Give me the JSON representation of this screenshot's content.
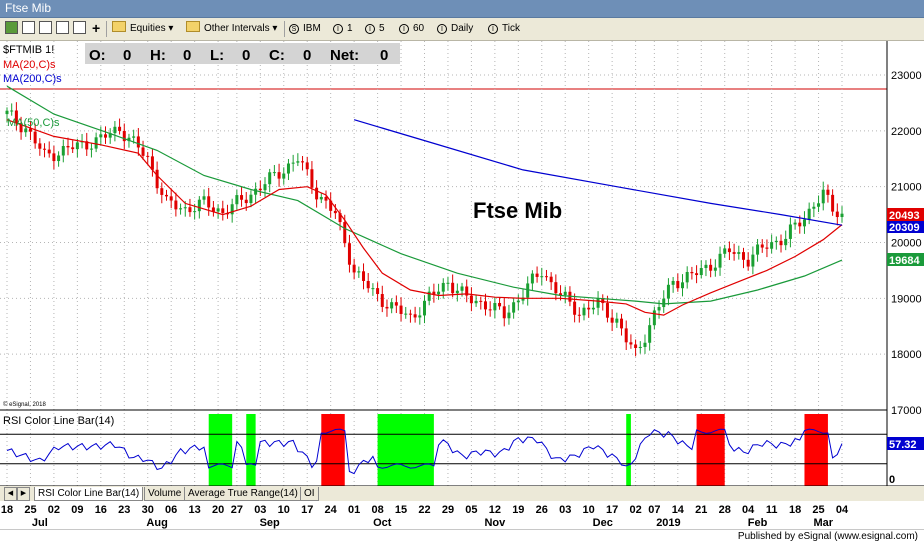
{
  "window": {
    "title": "Ftse Mib"
  },
  "toolbar": {
    "equities": "Equities",
    "other_intervals": "Other Intervals",
    "symbol": "IBM",
    "int1": "1",
    "int5": "5",
    "int60": "60",
    "daily": "Daily",
    "tick": "Tick"
  },
  "chart": {
    "symbol_label": "$FTMIB 1!",
    "ohlc_o": "O:",
    "ohlc_o_val": "0",
    "ohlc_h": "H:",
    "ohlc_h_val": "0",
    "ohlc_l": "L:",
    "ohlc_l_val": "0",
    "ohlc_c": "C:",
    "ohlc_c_val": "0",
    "ohlc_net": "Net:",
    "ohlc_net_val": "0",
    "ma20_label": "MA(20,C)s",
    "ma200_label": "MA(200,C)s",
    "ma50_label": "MA(50,C)s",
    "annotation": "Ftse Mib",
    "copyright": "© eSignal, 2018",
    "last_price": "20493",
    "ma200_value": "20309",
    "ma50_value": "19684",
    "rsi_label": "RSI Color Line Bar(14)",
    "rsi_value": "57.32",
    "rsi_axis_zero": "0"
  },
  "chart_data": {
    "type": "candlestick",
    "title": "Ftse Mib",
    "ylim": [
      17000,
      23500
    ],
    "y_ticks": [
      "23000",
      "22000",
      "21000",
      "20000",
      "19000",
      "18000",
      "17000"
    ],
    "resistance_line": 22750,
    "x_tick_labels": [
      "18",
      "25",
      "02",
      "09",
      "16",
      "23",
      "30",
      "06",
      "13",
      "20",
      "27",
      "03",
      "10",
      "17",
      "24",
      "01",
      "08",
      "15",
      "22",
      "29",
      "05",
      "12",
      "19",
      "26",
      "03",
      "10",
      "17",
      "02",
      "07",
      "14",
      "21",
      "28",
      "04",
      "11",
      "18",
      "25",
      "04"
    ],
    "month_labels": [
      "Jul",
      "Aug",
      "Sep",
      "Oct",
      "Nov",
      "Dec",
      "2019",
      "Feb",
      "Mar"
    ],
    "close_path": [
      [
        0,
        22300
      ],
      [
        4,
        22050
      ],
      [
        8,
        21550
      ],
      [
        12,
        21650
      ],
      [
        16,
        21750
      ],
      [
        20,
        21850
      ],
      [
        24,
        22050
      ],
      [
        30,
        21500
      ],
      [
        34,
        20700
      ],
      [
        38,
        20600
      ],
      [
        42,
        20700
      ],
      [
        46,
        20550
      ],
      [
        50,
        20750
      ],
      [
        54,
        21000
      ],
      [
        58,
        21250
      ],
      [
        62,
        21500
      ],
      [
        66,
        20900
      ],
      [
        70,
        20500
      ],
      [
        74,
        19500
      ],
      [
        78,
        19100
      ],
      [
        82,
        18850
      ],
      [
        86,
        18650
      ],
      [
        90,
        19000
      ],
      [
        94,
        19300
      ],
      [
        98,
        19000
      ],
      [
        102,
        18900
      ],
      [
        106,
        18700
      ],
      [
        110,
        19100
      ],
      [
        114,
        19500
      ],
      [
        118,
        19050
      ],
      [
        122,
        18750
      ],
      [
        126,
        18900
      ],
      [
        130,
        18600
      ],
      [
        132,
        18250
      ],
      [
        134,
        18000
      ],
      [
        138,
        18700
      ],
      [
        142,
        19300
      ],
      [
        146,
        19400
      ],
      [
        150,
        19600
      ],
      [
        154,
        19850
      ],
      [
        158,
        19700
      ],
      [
        162,
        19950
      ],
      [
        166,
        20100
      ],
      [
        170,
        20450
      ],
      [
        172,
        20700
      ],
      [
        174,
        20850
      ],
      [
        176,
        20600
      ],
      [
        178,
        20500
      ]
    ],
    "ma20": [
      [
        0,
        22200
      ],
      [
        10,
        21900
      ],
      [
        20,
        21750
      ],
      [
        28,
        21600
      ],
      [
        32,
        21200
      ],
      [
        38,
        20700
      ],
      [
        46,
        20500
      ],
      [
        52,
        20650
      ],
      [
        58,
        20950
      ],
      [
        64,
        21000
      ],
      [
        68,
        20850
      ],
      [
        72,
        20400
      ],
      [
        76,
        19900
      ],
      [
        80,
        19450
      ],
      [
        86,
        19150
      ],
      [
        92,
        19050
      ],
      [
        98,
        19080
      ],
      [
        104,
        19020
      ],
      [
        110,
        19000
      ],
      [
        118,
        19000
      ],
      [
        126,
        18950
      ],
      [
        132,
        18900
      ],
      [
        136,
        18750
      ],
      [
        140,
        18700
      ],
      [
        144,
        18880
      ],
      [
        150,
        19100
      ],
      [
        156,
        19300
      ],
      [
        162,
        19500
      ],
      [
        168,
        19750
      ],
      [
        174,
        20050
      ],
      [
        178,
        20320
      ]
    ],
    "ma50": [
      [
        0,
        22800
      ],
      [
        10,
        22300
      ],
      [
        22,
        21950
      ],
      [
        32,
        21650
      ],
      [
        42,
        21200
      ],
      [
        52,
        20950
      ],
      [
        62,
        20750
      ],
      [
        72,
        20250
      ],
      [
        84,
        19800
      ],
      [
        96,
        19450
      ],
      [
        108,
        19200
      ],
      [
        118,
        19050
      ],
      [
        126,
        19000
      ],
      [
        134,
        18950
      ],
      [
        140,
        18900
      ],
      [
        150,
        18950
      ],
      [
        160,
        19150
      ],
      [
        170,
        19400
      ],
      [
        178,
        19684
      ]
    ],
    "ma200": [
      [
        74,
        22200
      ],
      [
        90,
        21800
      ],
      [
        110,
        21300
      ],
      [
        130,
        21000
      ],
      [
        150,
        20700
      ],
      [
        165,
        20500
      ],
      [
        178,
        20309
      ]
    ],
    "rsi": {
      "range": [
        0,
        100
      ],
      "upper": 70,
      "lower": 30,
      "last": 57.32,
      "overbought_zones": [
        [
          67,
          72
        ],
        [
          147,
          153
        ],
        [
          170,
          175
        ]
      ],
      "oversold_zones": [
        [
          43,
          48
        ],
        [
          51,
          53
        ],
        [
          79,
          91
        ],
        [
          132,
          133
        ]
      ]
    }
  }
}
